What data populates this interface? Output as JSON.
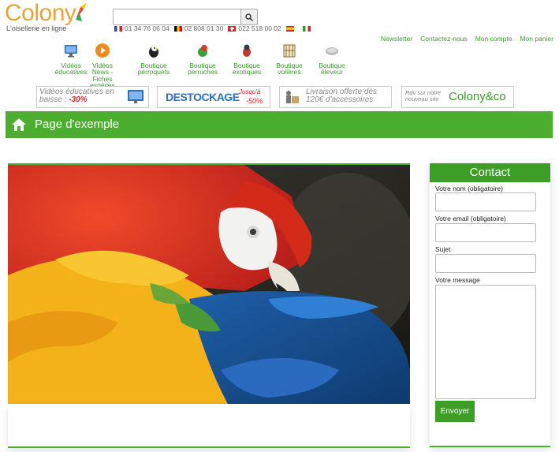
{
  "header": {
    "logo_text": "Colony",
    "tagline": "L'oisellerie en ligne",
    "search": {
      "placeholder": "",
      "value": ""
    },
    "phones": [
      {
        "flag": "fr",
        "number": "01 34 76 06 04"
      },
      {
        "flag": "be",
        "number": "02 808 01 30"
      },
      {
        "flag": "ch",
        "number": "022 518 00 02"
      },
      {
        "flag": "es",
        "number": ""
      },
      {
        "flag": "it",
        "number": ""
      }
    ],
    "links": [
      "Newsletter",
      "Contactez-nous",
      "Mon compte",
      "Mon panier"
    ]
  },
  "nav": [
    {
      "label": "Vidéos éducatives",
      "icon": "monitor-icon"
    },
    {
      "label": "Vidéos News - Fiches espèces",
      "icon": "play-icon"
    },
    {
      "label": "Boutique perroquets",
      "icon": "parrot-icon"
    },
    {
      "label": "Boutique perruches",
      "icon": "parakeet-icon"
    },
    {
      "label": "Boutique exotiques",
      "icon": "exotic-bird-icon"
    },
    {
      "label": "Boutique volières",
      "icon": "aviary-icon"
    },
    {
      "label": "Boutique éleveur",
      "icon": "breeder-icon"
    }
  ],
  "promos": {
    "videos": {
      "text": "Vidéos éducatives en baisse :",
      "discount": "-30%"
    },
    "destockage": {
      "title": "DESTOCKAGE",
      "line1": "Jusqu'à",
      "discount": "-50%"
    },
    "livraison": {
      "line1": "Livraison offerte dès",
      "line2": "120€ d'accessoires"
    },
    "rdv": {
      "small1": "Rdv sur notre",
      "small2": "nouveau site",
      "brand": "Colony&co"
    }
  },
  "page": {
    "title": "Page d'exemple"
  },
  "contact": {
    "title": "Contact",
    "name_label": "Votre nom (obligatoire)",
    "email_label": "Votre email (obligatoire)",
    "subject_label": "Sujet",
    "message_label": "Votre message",
    "submit_label": "Envoyer"
  },
  "colors": {
    "brand_green": "#4cae2f",
    "logo_orange": "#e8a33a"
  }
}
